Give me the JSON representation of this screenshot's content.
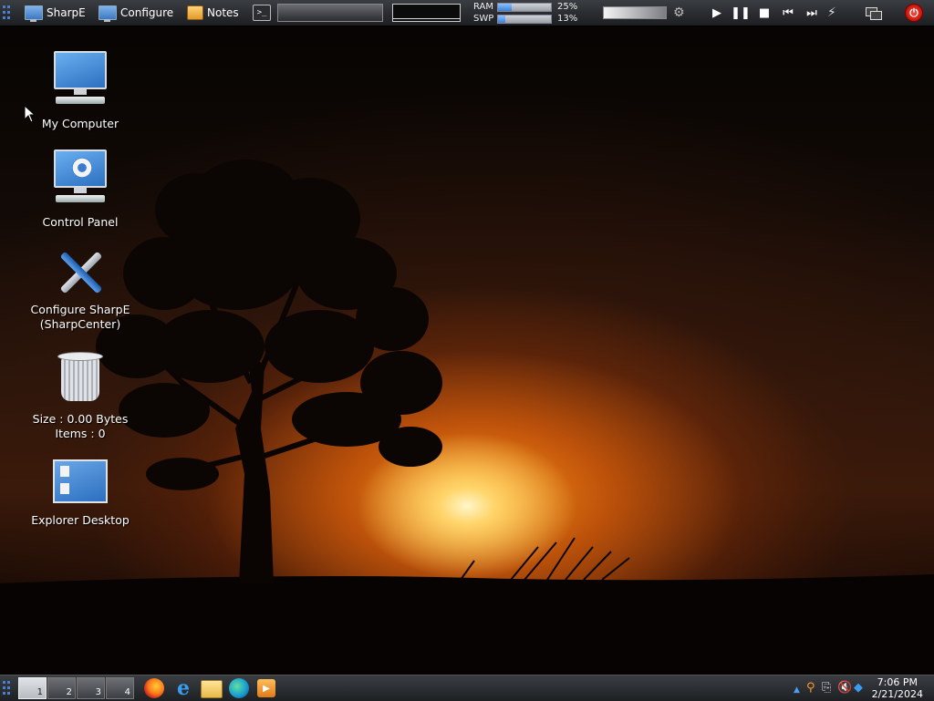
{
  "topbar": {
    "sharpe_label": "SharpE",
    "configure_label": "Configure",
    "notes_label": "Notes",
    "terminal_glyph": ">_",
    "ram_label": "RAM",
    "swp_label": "SWP",
    "ram_percent": "25%",
    "swp_percent": "13%",
    "ram_fraction": 0.25,
    "swp_fraction": 0.13
  },
  "desktop": {
    "icons": [
      {
        "label": "My Computer"
      },
      {
        "label": "Control Panel"
      },
      {
        "label": "Configure SharpE",
        "label2": "(SharpCenter)"
      },
      {
        "label": "Size : 0.00 Bytes",
        "label2": "Items : 0"
      },
      {
        "label": "Explorer Desktop"
      }
    ]
  },
  "taskbar": {
    "workspaces": [
      "1",
      "2",
      "3",
      "4"
    ],
    "apps": [
      "firefox-icon",
      "internet-explorer-icon",
      "file-explorer-icon",
      "edge-icon",
      "media-player-icon"
    ],
    "clock_time": "7:06 PM",
    "clock_date": "2/21/2024"
  },
  "colors": {
    "accent": "#3a7fd6",
    "power": "#d01a10"
  }
}
